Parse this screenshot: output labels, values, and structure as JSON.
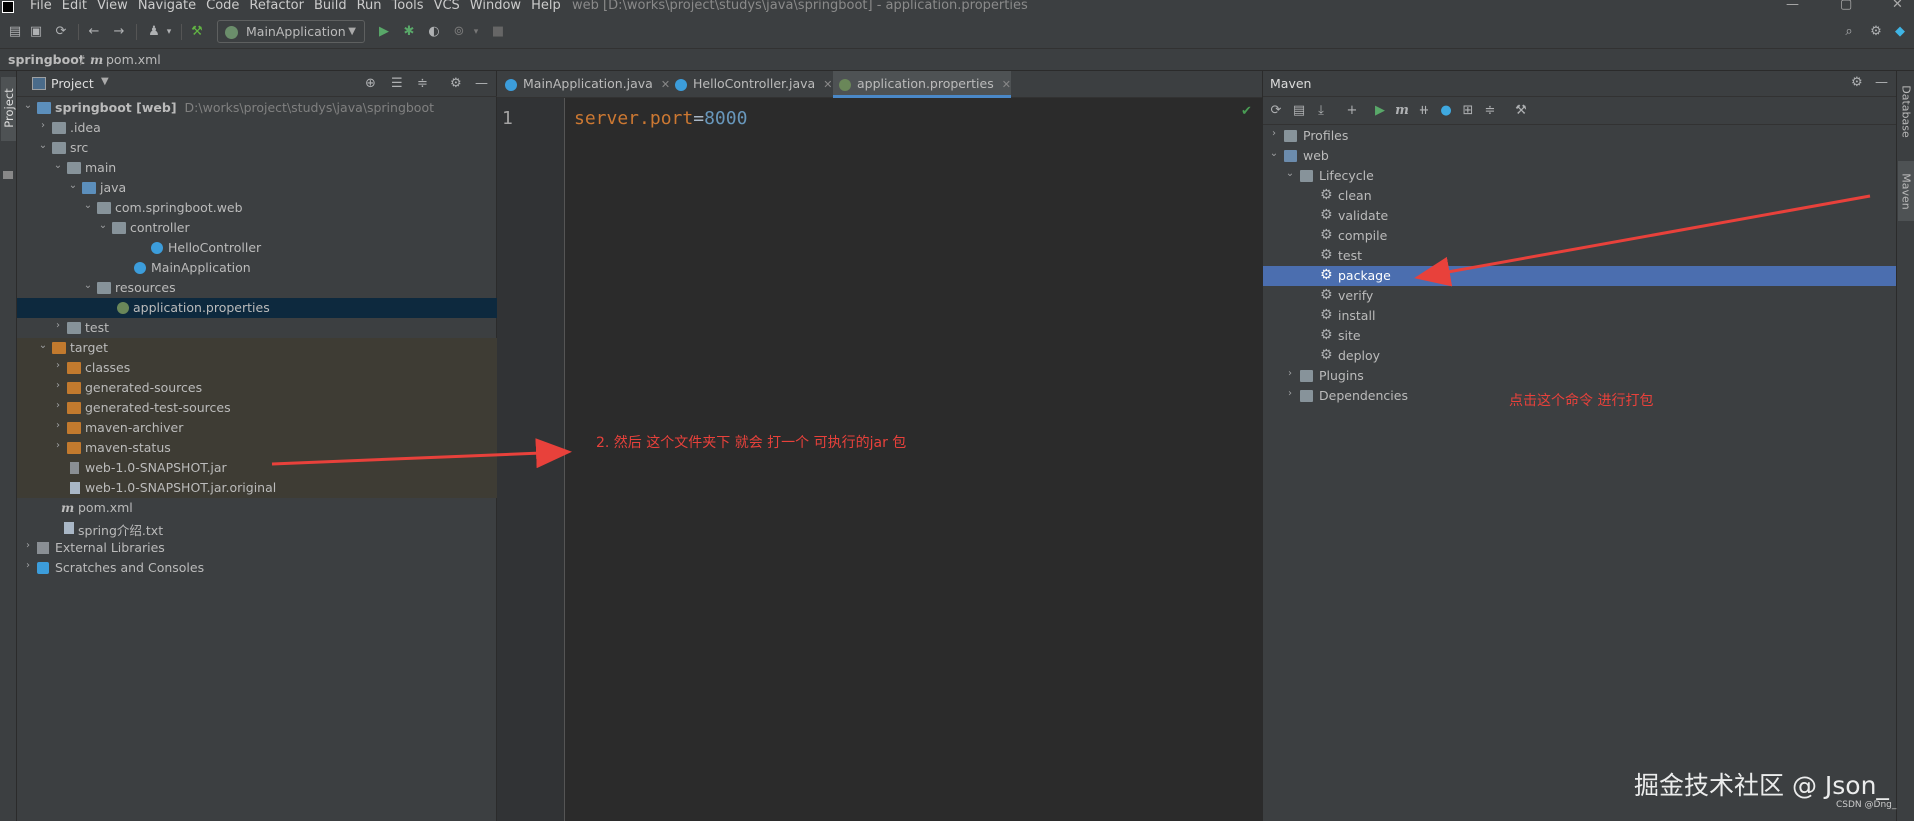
{
  "menubar": {
    "items": [
      "File",
      "Edit",
      "View",
      "Navigate",
      "Code",
      "Refactor",
      "Build",
      "Run",
      "Tools",
      "VCS",
      "Window",
      "Help"
    ],
    "window_title": "web [D:\\works\\project\\studys\\java\\springboot] - application.properties"
  },
  "toolbar": {
    "run_config": "MainApplication",
    "icons": [
      "open-icon",
      "save-icon",
      "sync-icon",
      "back-icon",
      "forward-icon",
      "user-icon",
      "build-icon",
      "run-icon",
      "debug-icon",
      "coverage-icon",
      "profile-icon",
      "stop-icon",
      "search-icon",
      "settings-icon",
      "jetbrains-icon"
    ]
  },
  "navbar": {
    "project": "springboot",
    "file": "pom.xml",
    "file_glyph": "m"
  },
  "left_strip": {
    "tab_label": "Project"
  },
  "project_panel": {
    "title": "Project",
    "tree": [
      {
        "label": "springboot [web]",
        "path": "D:\\works\\project\\studys\\java\\springboot"
      },
      {
        "label": ".idea"
      },
      {
        "label": "src"
      },
      {
        "label": "main"
      },
      {
        "label": "java"
      },
      {
        "label": "com.springboot.web"
      },
      {
        "label": "controller"
      },
      {
        "label": "HelloController"
      },
      {
        "label": "MainApplication"
      },
      {
        "label": "resources"
      },
      {
        "label": "application.properties"
      },
      {
        "label": "test"
      },
      {
        "label": "target"
      },
      {
        "label": "classes"
      },
      {
        "label": "generated-sources"
      },
      {
        "label": "generated-test-sources"
      },
      {
        "label": "maven-archiver"
      },
      {
        "label": "maven-status"
      },
      {
        "label": "web-1.0-SNAPSHOT.jar"
      },
      {
        "label": "web-1.0-SNAPSHOT.jar.original"
      },
      {
        "label": "pom.xml",
        "glyph": "m"
      },
      {
        "label": "spring介绍.txt"
      },
      {
        "label": "External Libraries"
      },
      {
        "label": "Scratches and Consoles"
      }
    ]
  },
  "editor": {
    "tabs": [
      "MainApplication.java",
      "HelloController.java",
      "application.properties"
    ],
    "active_tab": "application.properties",
    "line_number": "1",
    "code": {
      "key": "server.port",
      "eq": "=",
      "value": "8000"
    }
  },
  "annotations": {
    "jar_note": "2. 然后 这个文件夹下 就会 打一个 可执行的jar 包",
    "package_note": "点击这个命令  进行打包",
    "color": "#e8413b"
  },
  "maven_panel": {
    "title": "Maven",
    "tree": [
      {
        "label": "Profiles"
      },
      {
        "label": "web"
      },
      {
        "label": "Lifecycle"
      },
      {
        "label": "clean"
      },
      {
        "label": "validate"
      },
      {
        "label": "compile"
      },
      {
        "label": "test"
      },
      {
        "label": "package"
      },
      {
        "label": "verify"
      },
      {
        "label": "install"
      },
      {
        "label": "site"
      },
      {
        "label": "deploy"
      },
      {
        "label": "Plugins"
      },
      {
        "label": "Dependencies"
      }
    ],
    "selected": "package"
  },
  "right_strip": {
    "tabs": [
      "Database",
      "Maven"
    ]
  },
  "watermark": {
    "main": "掘金技术社区 @ Json_",
    "sub": "CSDN @Dng_"
  },
  "colors": {
    "accent": "#4b6eaf",
    "selection": "#0d293e",
    "target_highlight": "#3e3c34"
  }
}
